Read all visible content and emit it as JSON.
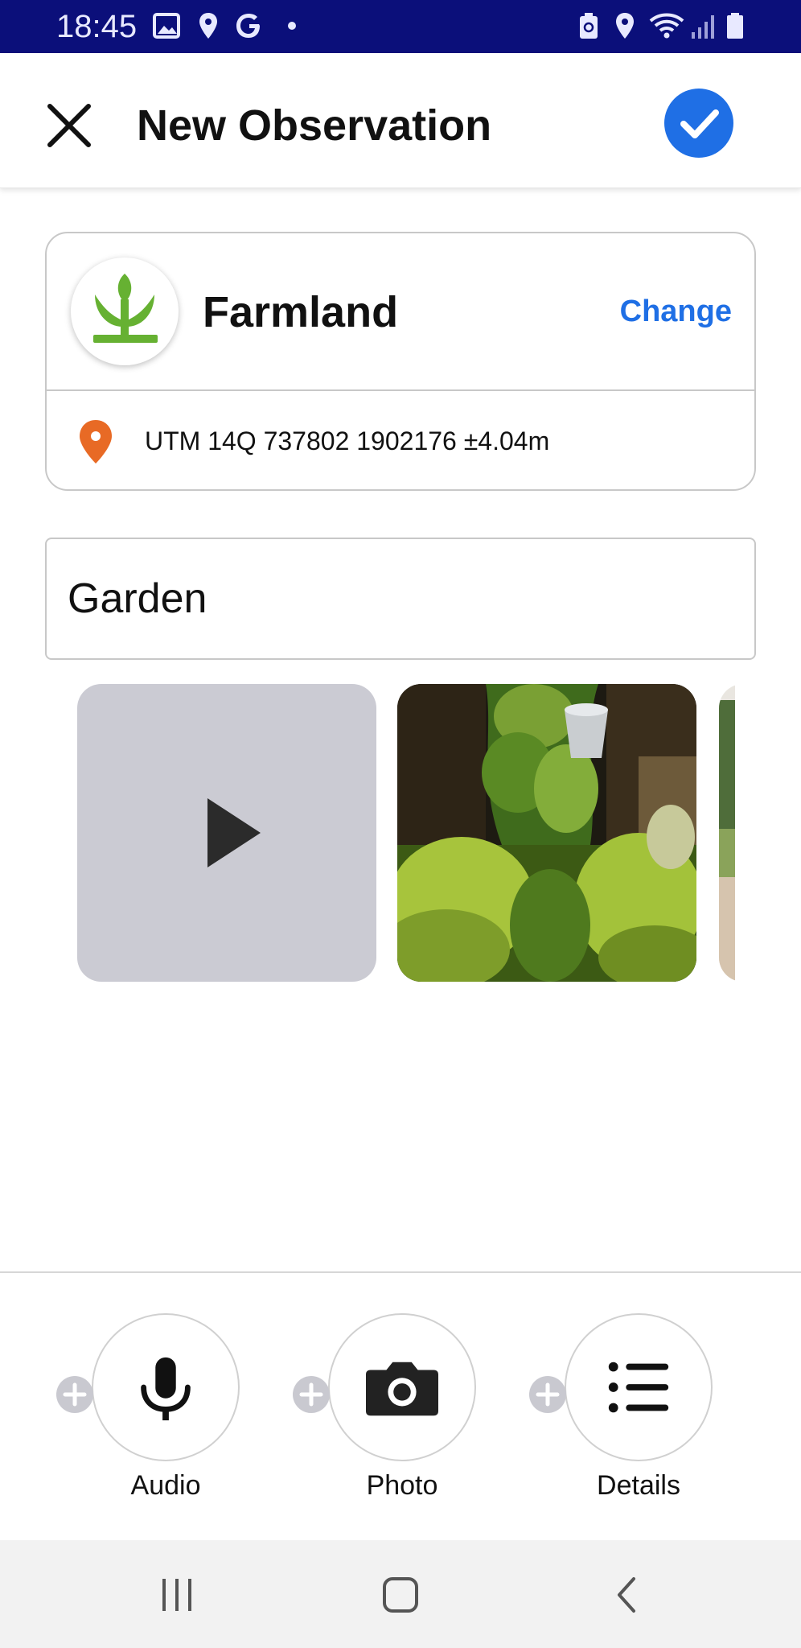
{
  "status_bar": {
    "time": "18:45",
    "left_icons": [
      "image-icon",
      "location-icon",
      "google-icon",
      "dot-icon"
    ],
    "right_icons": [
      "battery-saver-icon",
      "location-icon",
      "wifi-icon",
      "signal-icon",
      "battery-icon"
    ]
  },
  "app_bar": {
    "title": "New Observation",
    "close_icon": "close-icon",
    "confirm_icon": "check-icon",
    "accent_color": "#1f6fe5"
  },
  "category": {
    "name": "Farmland",
    "icon": "sprout-icon",
    "change_label": "Change"
  },
  "location": {
    "icon": "map-pin-icon",
    "text": "UTM 14Q 737802 1902176 ±4.04m",
    "pin_color": "#e86a25"
  },
  "notes": {
    "value": "Garden"
  },
  "media": [
    {
      "type": "audio",
      "icon": "play-icon"
    },
    {
      "type": "photo",
      "description_icon": "garden-photo"
    },
    {
      "type": "photo",
      "description_icon": "garden-photo-partial"
    }
  ],
  "actions": [
    {
      "label": "Audio",
      "icon": "microphone-icon"
    },
    {
      "label": "Photo",
      "icon": "camera-icon"
    },
    {
      "label": "Details",
      "icon": "list-icon"
    }
  ],
  "nav_bar": {
    "buttons": [
      "recent-apps-icon",
      "home-icon",
      "back-icon"
    ]
  }
}
